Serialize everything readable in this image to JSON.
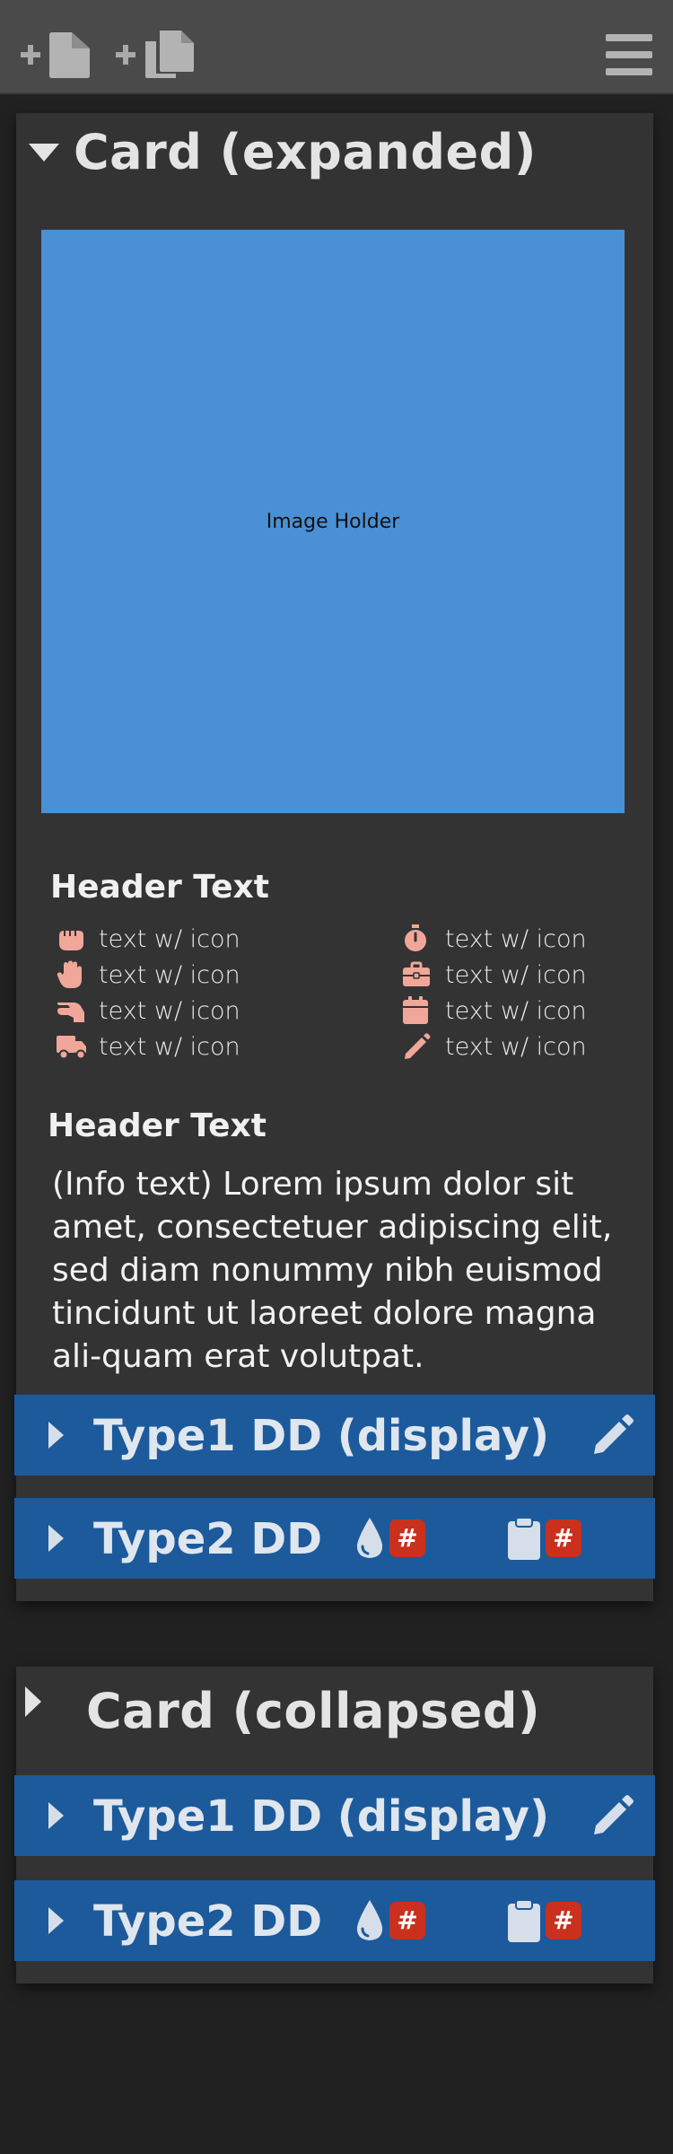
{
  "toolbar": {
    "new_icon": "plus-file-icon",
    "duplicate_icon": "plus-copy-icon",
    "menu_icon": "hamburger-menu-icon"
  },
  "cards": {
    "expanded": {
      "title": "Card (expanded)",
      "image_placeholder": "Image Holder",
      "icon_section_header": "Header Text",
      "icon_items_left": [
        {
          "icon": "hand-rock-icon",
          "label": "text w/ icon"
        },
        {
          "icon": "hand-paper-icon",
          "label": "text w/ icon"
        },
        {
          "icon": "hand-lizard-icon",
          "label": "text w/ icon"
        },
        {
          "icon": "truck-icon",
          "label": "text w/ icon"
        }
      ],
      "icon_items_right": [
        {
          "icon": "stopwatch-icon",
          "label": "text w/ icon"
        },
        {
          "icon": "briefcase-icon",
          "label": "text w/ icon"
        },
        {
          "icon": "calendar-icon",
          "label": "text w/ icon"
        },
        {
          "icon": "pencil-icon",
          "label": "text w/ icon"
        }
      ],
      "info_section_header": "Header Text",
      "info_text": "(Info text) Lorem ipsum dolor sit amet, consectetuer adipiscing elit, sed diam nonummy nibh euismod tincidunt ut laoreet dolore magna ali-quam erat volutpat.",
      "dropdowns": [
        {
          "label": "Type1 DD (display)",
          "action_icon": "pencil-icon"
        },
        {
          "label": "Type2 DD",
          "metrics": [
            {
              "icon": "drop-icon",
              "badge": "#"
            },
            {
              "icon": "clipboard-icon",
              "badge": "#"
            }
          ]
        }
      ]
    },
    "collapsed": {
      "title": "Card (collapsed)",
      "dropdowns": [
        {
          "label": "Type1 DD (display)",
          "action_icon": "pencil-icon"
        },
        {
          "label": "Type2 DD",
          "metrics": [
            {
              "icon": "drop-icon",
              "badge": "#"
            },
            {
              "icon": "clipboard-icon",
              "badge": "#"
            }
          ]
        }
      ]
    }
  },
  "colors": {
    "background": "#212121",
    "toolbar": "#4a4a4a",
    "card": "#333333",
    "dropdown_bar": "#1c5a9c",
    "image_placeholder": "#4a90d5",
    "icon_accent": "#f0a79a",
    "badge": "#c9301e"
  }
}
